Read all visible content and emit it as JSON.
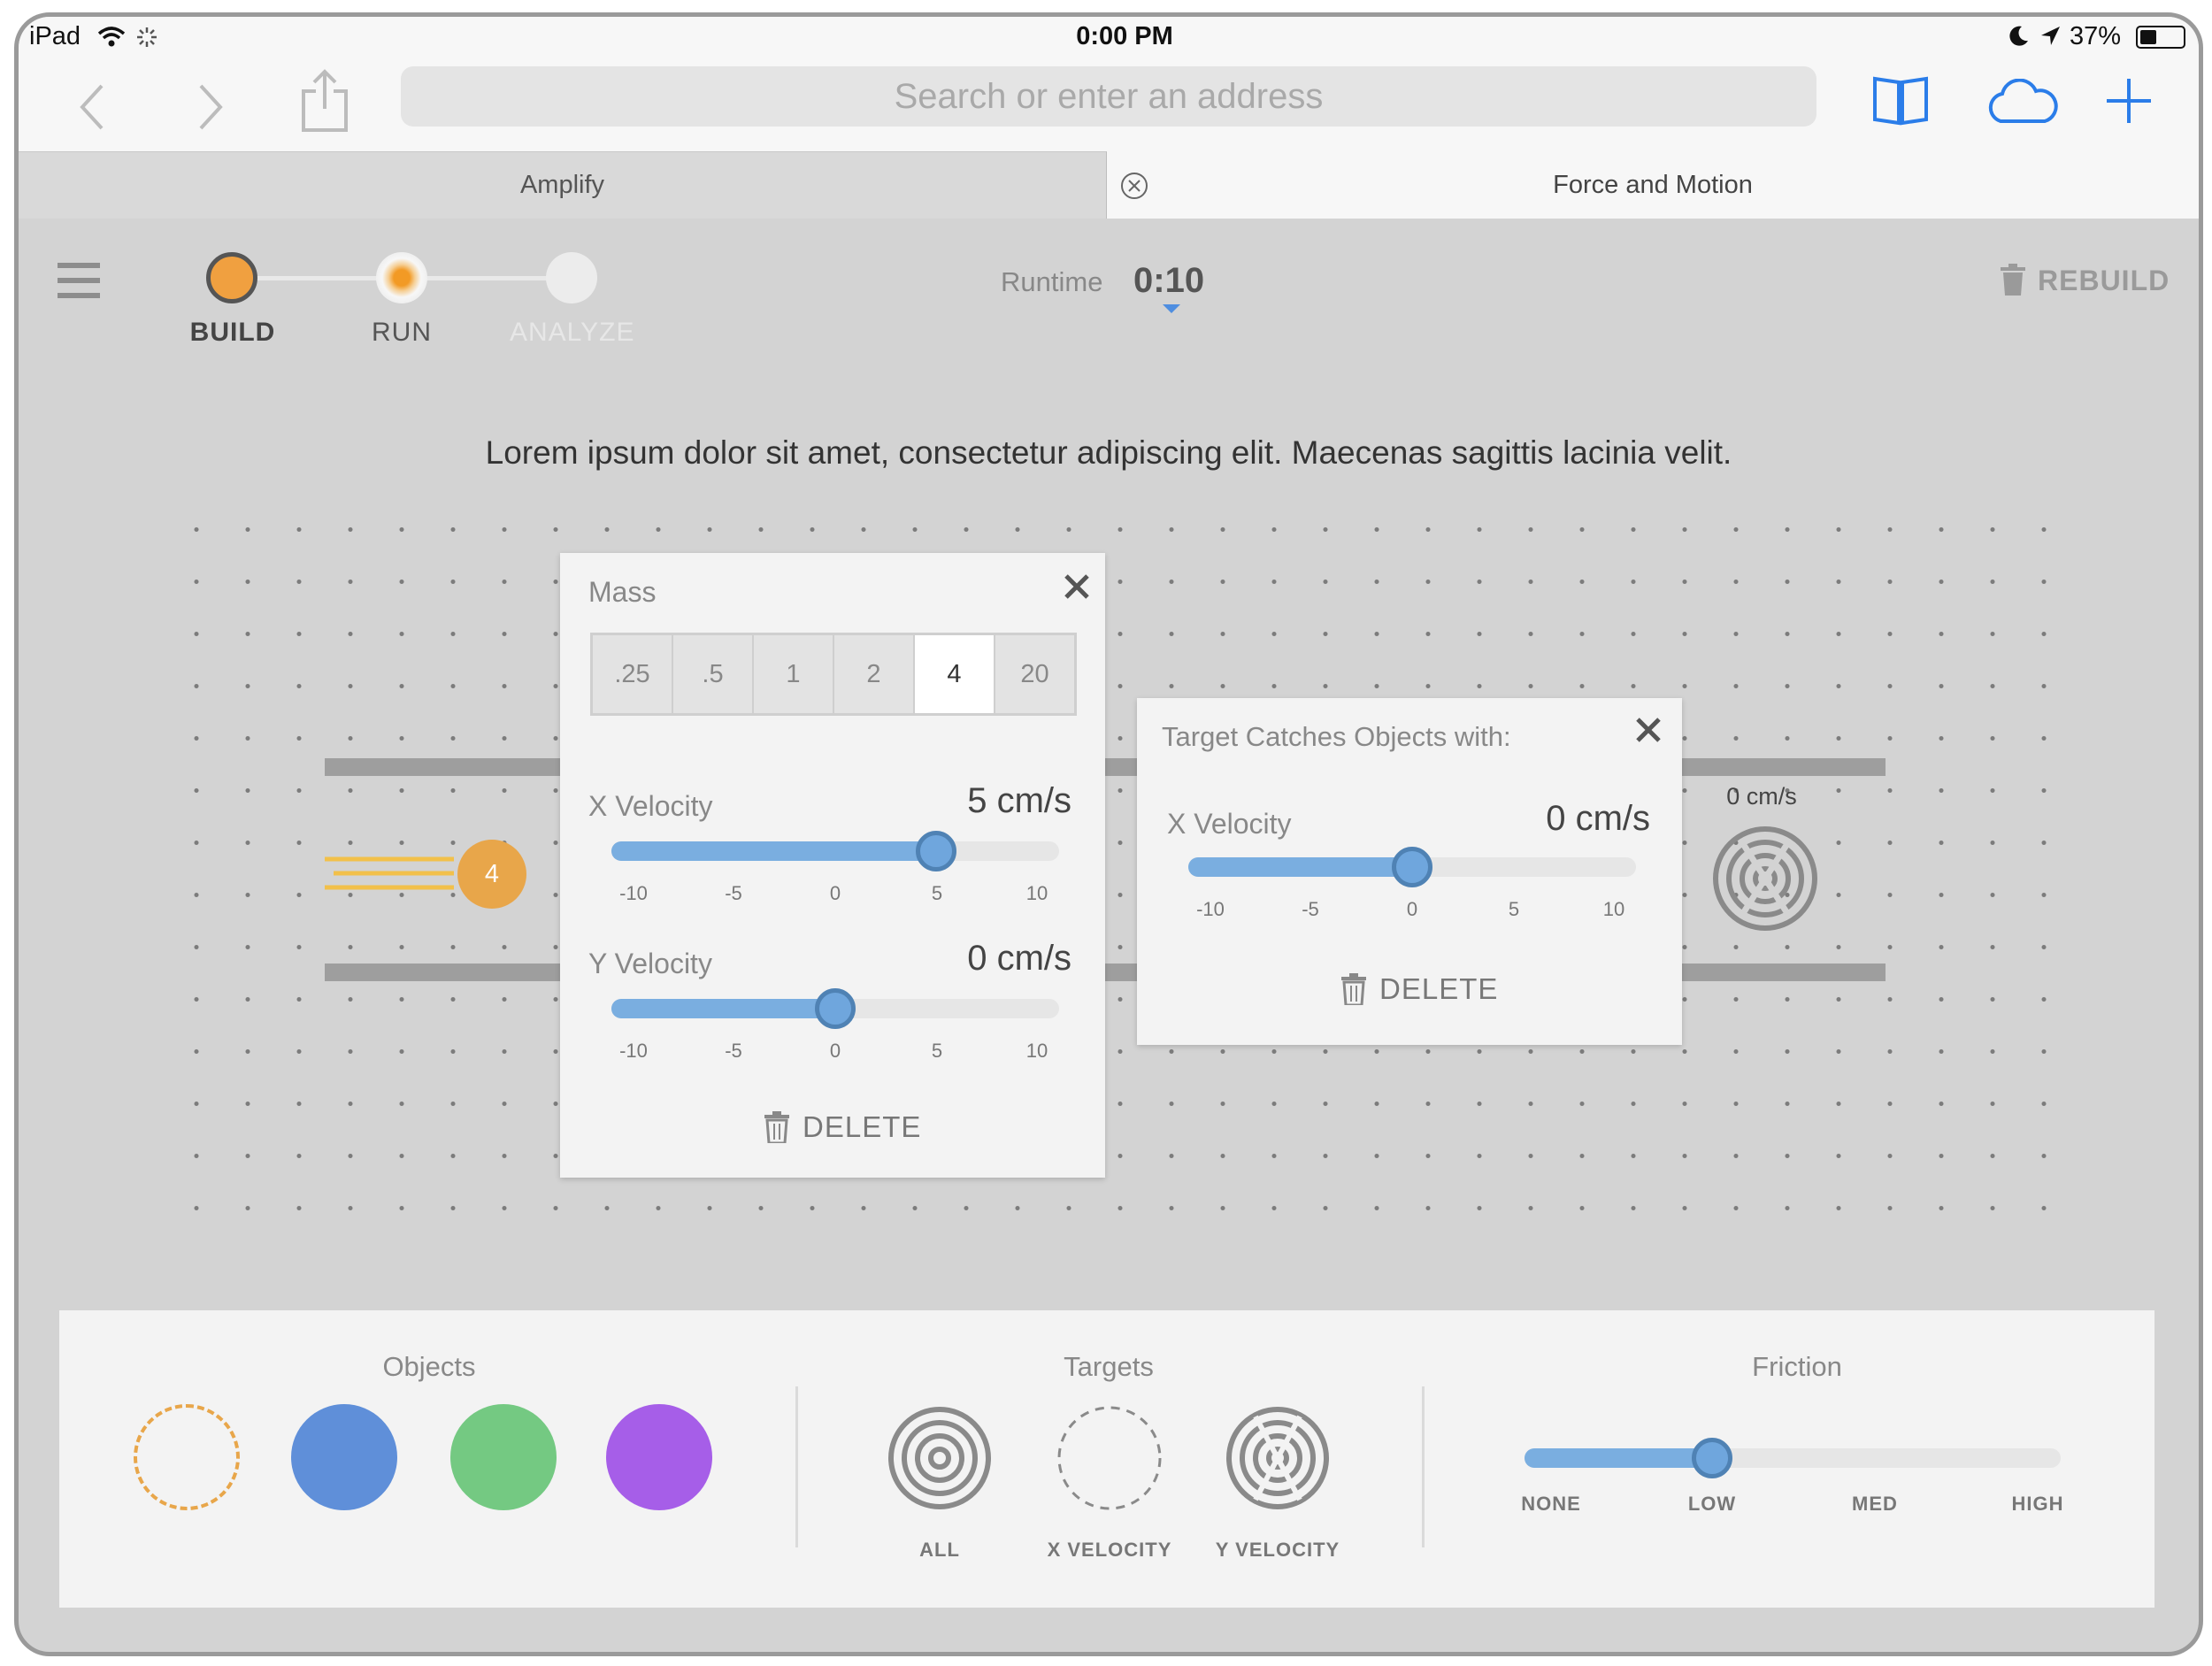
{
  "status_bar": {
    "device": "iPad",
    "time": "0:00 PM",
    "battery": "37%"
  },
  "browser": {
    "search_placeholder": "Search or enter an address",
    "tabs": [
      {
        "label": "Amplify"
      },
      {
        "label": "Force and Motion"
      }
    ]
  },
  "app": {
    "steps": [
      {
        "label": "BUILD",
        "state": "complete"
      },
      {
        "label": "RUN",
        "state": "current"
      },
      {
        "label": "ANALYZE",
        "state": "inactive"
      }
    ],
    "runtime_label": "Runtime",
    "runtime_value": "0:10",
    "rebuild_label": "REBUILD",
    "instruction": "Lorem ipsum dolor sit amet, consectetur adipiscing elit. Maecenas sagittis lacinia velit."
  },
  "scene": {
    "object_mass_label": "4",
    "target_velocity_label": "0 cm/s",
    "object_color": "#e8a64a"
  },
  "mass_popup": {
    "title": "Mass",
    "options": [
      ".25",
      ".5",
      "1",
      "2",
      "4",
      "20"
    ],
    "selected": "4",
    "x_velocity": {
      "label": "X Velocity",
      "display": "5 cm/s",
      "value": 5,
      "min": -10,
      "max": 10
    },
    "y_velocity": {
      "label": "Y Velocity",
      "display": "0 cm/s",
      "value": 0,
      "min": -10,
      "max": 10
    },
    "ticks": [
      "-10",
      "-5",
      "0",
      "5",
      "10"
    ],
    "delete_label": "DELETE"
  },
  "target_popup": {
    "title": "Target Catches Objects with:",
    "x_velocity": {
      "label": "X Velocity",
      "display": "0 cm/s",
      "value": 0,
      "min": -10,
      "max": 10
    },
    "ticks": [
      "-10",
      "-5",
      "0",
      "5",
      "10"
    ],
    "delete_label": "DELETE"
  },
  "palette": {
    "objects_title": "Objects",
    "objects": [
      {
        "name": "empty",
        "color": "#e8a64a"
      },
      {
        "name": "blue",
        "color": "#5f8fd9"
      },
      {
        "name": "green",
        "color": "#74c982"
      },
      {
        "name": "purple",
        "color": "#a65ee8"
      }
    ],
    "targets_title": "Targets",
    "targets": [
      {
        "label": "ALL"
      },
      {
        "label": "X VELOCITY"
      },
      {
        "label": "Y VELOCITY"
      }
    ],
    "friction_title": "Friction",
    "friction_levels": [
      "NONE",
      "LOW",
      "MED",
      "HIGH"
    ],
    "friction_selected": "LOW",
    "friction_value": 0.333
  },
  "colors": {
    "accent_orange": "#f0a040",
    "slider_blue": "#7aaee0",
    "slider_thumb_border": "#4f82b4"
  }
}
